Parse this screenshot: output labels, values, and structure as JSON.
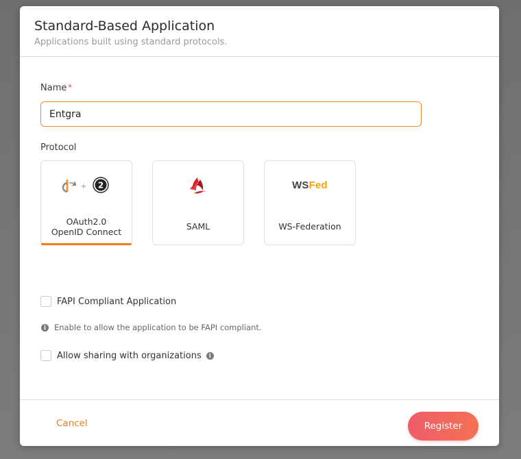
{
  "modal": {
    "title": "Standard-Based Application",
    "subtitle": "Applications built using standard protocols."
  },
  "form": {
    "name_label": "Name",
    "name_required_marker": "*",
    "name_value": "Entgra",
    "protocol_label": "Protocol",
    "protocols": [
      {
        "label_line1": "OAuth2.0",
        "label_line2": "OpenID Connect",
        "selected": true,
        "icon": "oauth-openid-icon"
      },
      {
        "label": "SAML",
        "selected": false,
        "icon": "saml-icon"
      },
      {
        "label": "WS-Federation",
        "selected": false,
        "icon": "wsfed-icon",
        "logo_ws": "WS",
        "logo_fed": "Fed"
      }
    ],
    "fapi_label": "FAPI Compliant Application",
    "fapi_checked": false,
    "fapi_hint": "Enable to allow the application to be FAPI compliant.",
    "sharing_label": "Allow sharing with organizations",
    "sharing_checked": false
  },
  "footer": {
    "cancel_label": "Cancel",
    "register_label": "Register"
  },
  "colors": {
    "accent_orange": "#f07d1a",
    "register_gradient_start": "#ef5b6a",
    "register_gradient_end": "#f57152",
    "saml_red": "#d92027",
    "wsfed_yellow": "#f5a300"
  }
}
